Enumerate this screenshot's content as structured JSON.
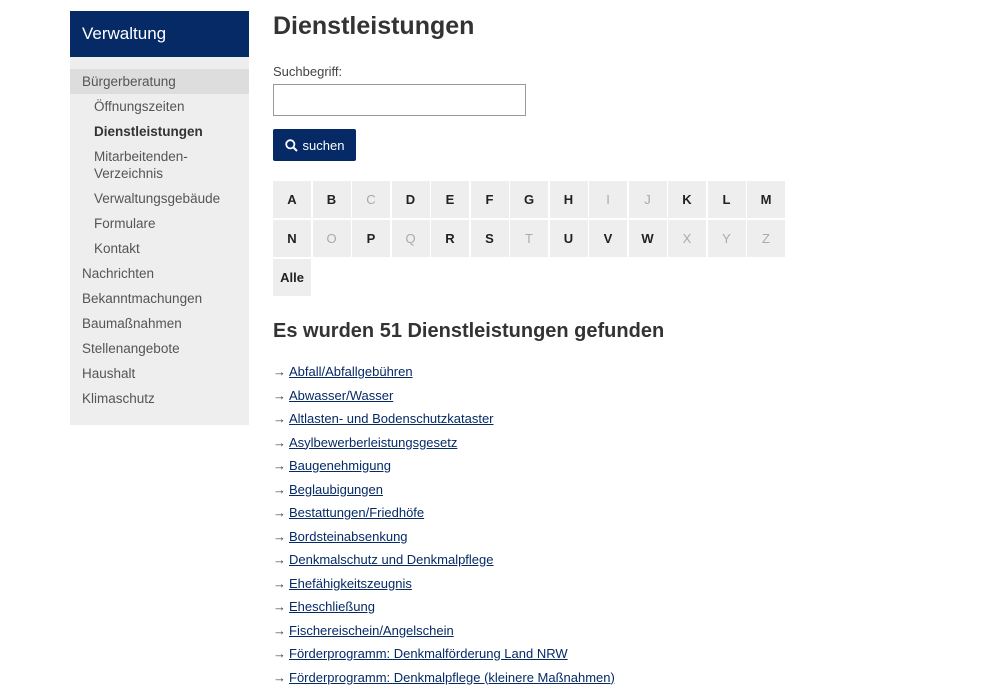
{
  "sidebar": {
    "title": "Verwaltung",
    "items": [
      {
        "label": "Bürgerberatung",
        "level": 1,
        "active": true
      },
      {
        "label": "Öffnungszeiten",
        "level": 2
      },
      {
        "label": "Dienstleistungen",
        "level": 2,
        "current": true
      },
      {
        "label": "Mitarbeitenden-Verzeichnis",
        "level": 2
      },
      {
        "label": "Verwaltungsgebäude",
        "level": 2
      },
      {
        "label": "Formulare",
        "level": 2
      },
      {
        "label": "Kontakt",
        "level": 2
      },
      {
        "label": "Nachrichten",
        "level": 1
      },
      {
        "label": "Bekanntmachungen",
        "level": 1
      },
      {
        "label": "Baumaßnahmen",
        "level": 1
      },
      {
        "label": "Stellenangebote",
        "level": 1
      },
      {
        "label": "Haushalt",
        "level": 1
      },
      {
        "label": "Klimaschutz",
        "level": 1
      }
    ]
  },
  "main": {
    "title": "Dienstleistungen",
    "search": {
      "label": "Suchbegriff:",
      "value": "",
      "placeholder": "",
      "button_label": "suchen",
      "button_icon": "search-icon"
    },
    "alphabet": [
      {
        "letter": "A",
        "enabled": true
      },
      {
        "letter": "B",
        "enabled": true
      },
      {
        "letter": "C",
        "enabled": false
      },
      {
        "letter": "D",
        "enabled": true
      },
      {
        "letter": "E",
        "enabled": true
      },
      {
        "letter": "F",
        "enabled": true
      },
      {
        "letter": "G",
        "enabled": true
      },
      {
        "letter": "H",
        "enabled": true
      },
      {
        "letter": "I",
        "enabled": false
      },
      {
        "letter": "J",
        "enabled": false
      },
      {
        "letter": "K",
        "enabled": true
      },
      {
        "letter": "L",
        "enabled": true
      },
      {
        "letter": "M",
        "enabled": true
      },
      {
        "letter": "N",
        "enabled": true
      },
      {
        "letter": "O",
        "enabled": false
      },
      {
        "letter": "P",
        "enabled": true
      },
      {
        "letter": "Q",
        "enabled": false
      },
      {
        "letter": "R",
        "enabled": true
      },
      {
        "letter": "S",
        "enabled": true
      },
      {
        "letter": "T",
        "enabled": false
      },
      {
        "letter": "U",
        "enabled": true
      },
      {
        "letter": "V",
        "enabled": true
      },
      {
        "letter": "W",
        "enabled": true
      },
      {
        "letter": "X",
        "enabled": false
      },
      {
        "letter": "Y",
        "enabled": false
      },
      {
        "letter": "Z",
        "enabled": false
      },
      {
        "letter": "Alle",
        "enabled": true
      }
    ],
    "results_heading": "Es wurden 51 Dienstleistungen gefunden",
    "results": [
      "Abfall/Abfallgebühren",
      "Abwasser/Wasser",
      "Altlasten- und Bodenschutzkataster",
      "Asylbewerberleistungsgesetz",
      "Baugenehmigung",
      "Beglaubigungen",
      "Bestattungen/Friedhöfe",
      "Bordsteinabsenkung",
      "Denkmalschutz und Denkmalpflege",
      "Ehefähigkeitszeugnis",
      "Eheschließung",
      "Fischereischein/Angelschein",
      "Förderprogramm: Denkmalförderung Land NRW",
      "Förderprogramm: Denkmalpflege (kleinere Maßnahmen)"
    ]
  },
  "colors": {
    "brand": "#052a66",
    "sidebar_bg": "#eeeeee",
    "active_bg": "#dddddd",
    "tile_bg": "#eeeeee"
  }
}
